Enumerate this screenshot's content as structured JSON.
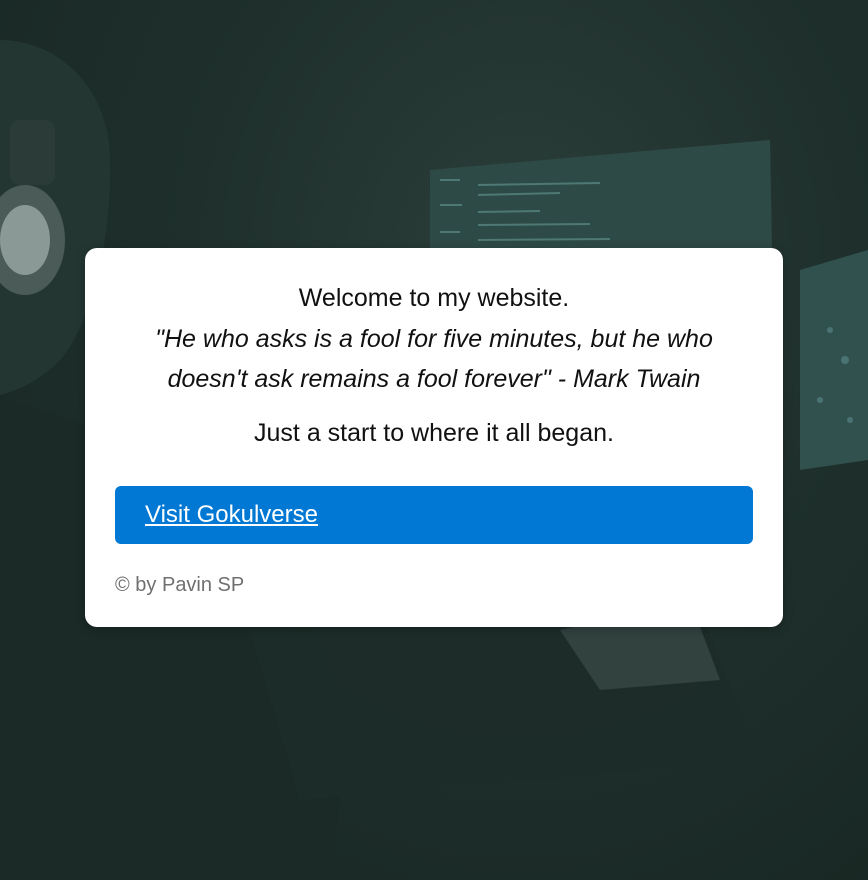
{
  "card": {
    "welcome": "Welcome to my website.",
    "quote": "\"He who asks is a fool for five minutes, but he who doesn't ask remains a fool forever\" - Mark Twain",
    "subtitle": "Just a start to where it all began.",
    "button_label": "Visit Gokulverse",
    "footer": "© by Pavin SP"
  },
  "colors": {
    "button": "#0078d4",
    "card_bg": "#ffffff",
    "footer_text": "#6f6f6f"
  }
}
